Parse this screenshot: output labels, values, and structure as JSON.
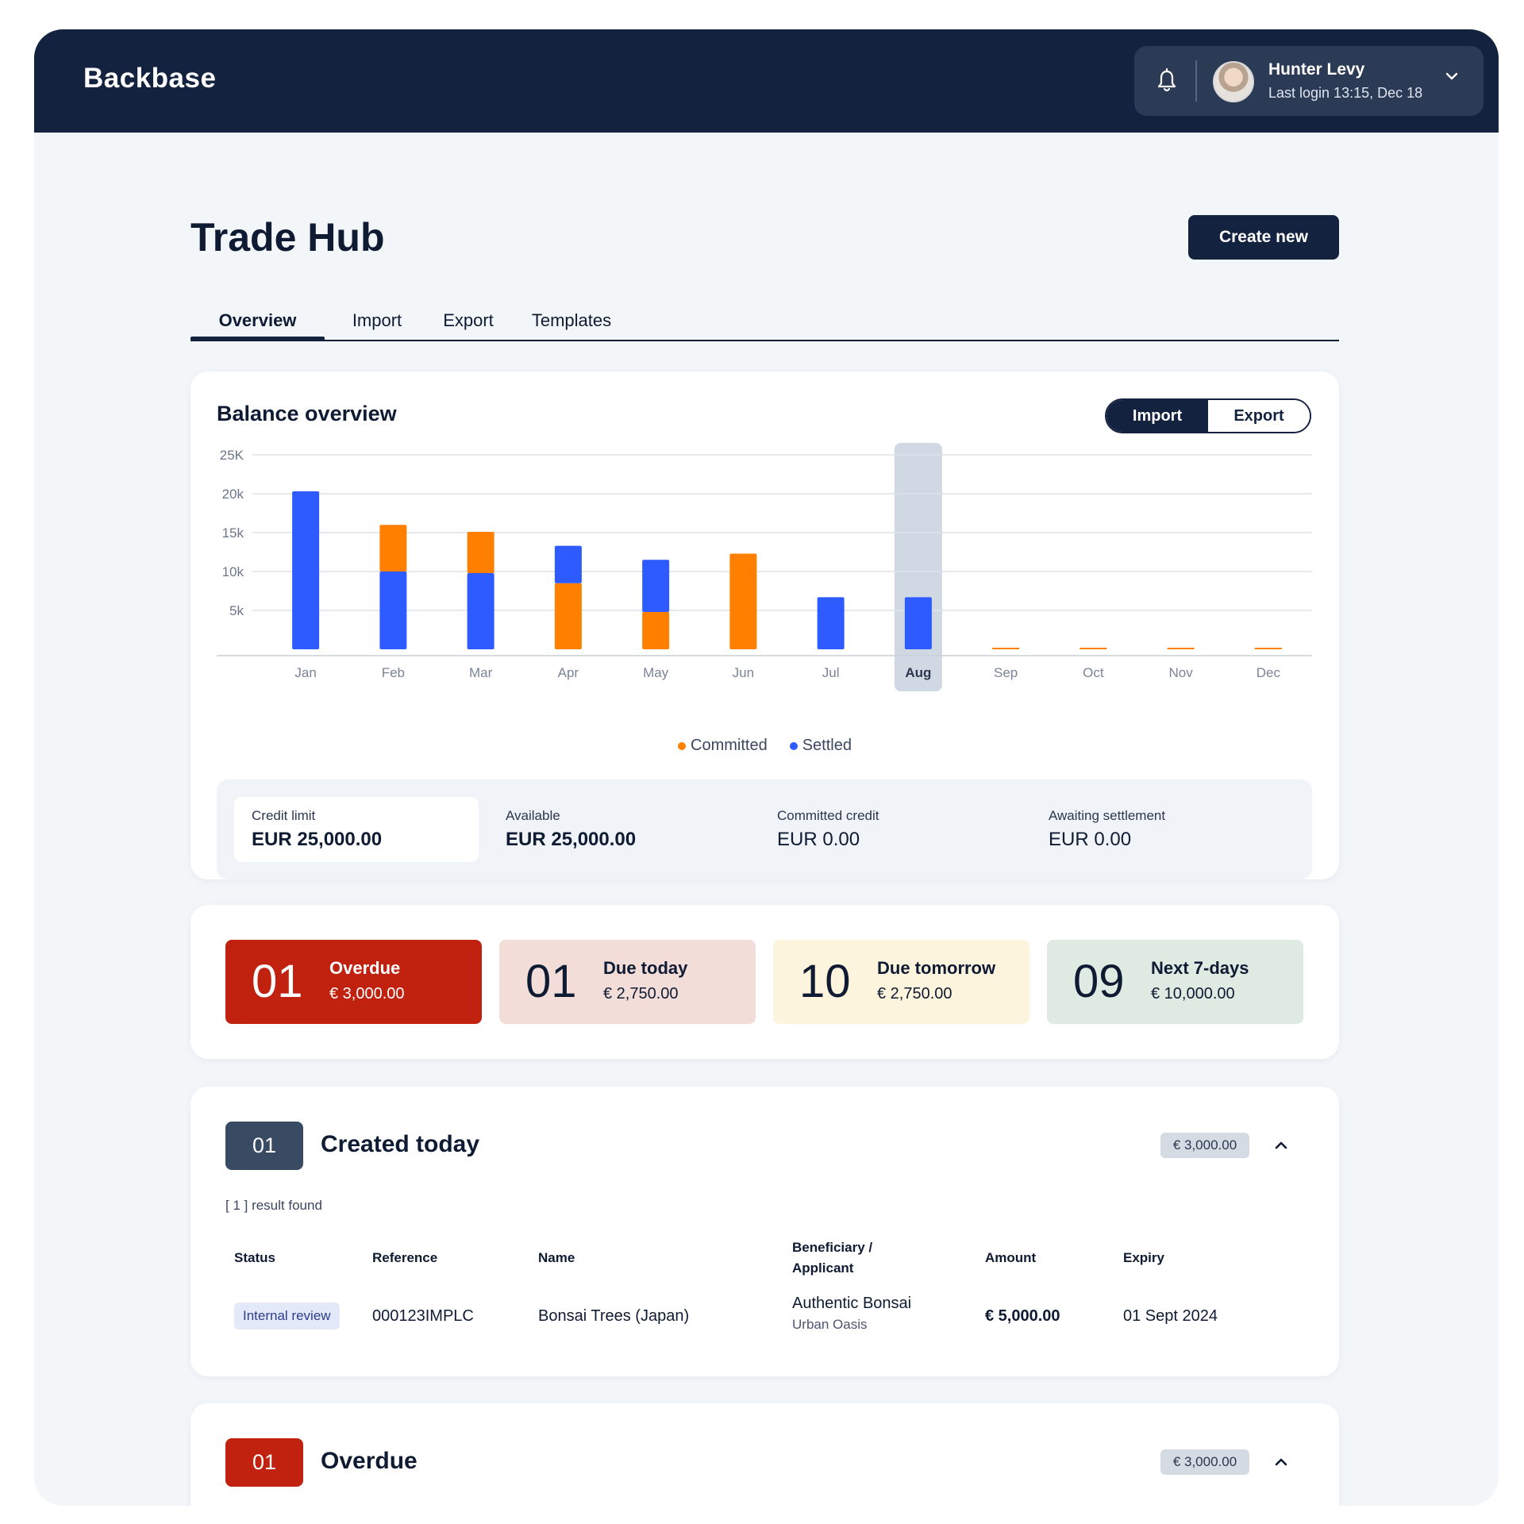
{
  "header": {
    "logo": "Backbase",
    "user_name": "Hunter Levy",
    "last_login": "Last login 13:15, Dec 18"
  },
  "page": {
    "title": "Trade Hub",
    "create_button": "Create new"
  },
  "tabs": [
    {
      "label": "Overview",
      "active": true
    },
    {
      "label": "Import",
      "active": false
    },
    {
      "label": "Export",
      "active": false
    },
    {
      "label": "Templates",
      "active": false
    }
  ],
  "balance": {
    "title": "Balance overview",
    "toggle": {
      "import_label": "Import",
      "export_label": "Export",
      "selected": "Import"
    },
    "legend": {
      "committed": "Committed",
      "settled": "Settled"
    },
    "summary": [
      {
        "label": "Credit limit",
        "value": "EUR 25,000.00"
      },
      {
        "label": "Available",
        "value": "EUR 25,000.00"
      },
      {
        "label": "Committed credit",
        "value": "EUR 0.00"
      },
      {
        "label": "Awaiting settlement",
        "value": "EUR 0.00"
      }
    ]
  },
  "chart_data": {
    "type": "bar",
    "stacked": true,
    "categories": [
      "Jan",
      "Feb",
      "Mar",
      "Apr",
      "May",
      "Jun",
      "Jul",
      "Aug",
      "Sep",
      "Oct",
      "Nov",
      "Dec"
    ],
    "highlighted_category": "Aug",
    "y_ticks": [
      "5k",
      "10k",
      "15k",
      "20k",
      "25K"
    ],
    "y_tick_values": [
      5000,
      10000,
      15000,
      20000,
      25000
    ],
    "ylim": [
      0,
      25000
    ],
    "grid": true,
    "legend_position": "bottom-center",
    "colors": {
      "Committed": "#ff7f00",
      "Settled": "#2e5bff"
    },
    "series": [
      {
        "name": "Settled",
        "values": [
          20300,
          10000,
          9800,
          4800,
          6700,
          0,
          6700,
          6700,
          0,
          0,
          0,
          0
        ]
      },
      {
        "name": "Committed",
        "values": [
          0,
          6000,
          5300,
          8500,
          4800,
          12300,
          0,
          0,
          0,
          0,
          0,
          0
        ]
      }
    ]
  },
  "status_tiles": [
    {
      "count": "01",
      "label": "Overdue",
      "amount": "€ 3,000.00",
      "bg": "#c0220f",
      "fg": "#ffffff"
    },
    {
      "count": "01",
      "label": "Due today",
      "amount": "€ 2,750.00",
      "bg": "#f3ddd9",
      "fg": "#0f1b33"
    },
    {
      "count": "10",
      "label": "Due tomorrow",
      "amount": "€ 2,750.00",
      "bg": "#fdf4de",
      "fg": "#0f1b33"
    },
    {
      "count": "09",
      "label": "Next 7-days",
      "amount": "€ 10,000.00",
      "bg": "#dfeae2",
      "fg": "#0f1b33"
    }
  ],
  "created_today": {
    "count": "01",
    "title": "Created today",
    "total": "€ 3,000.00",
    "result_count": "[ 1 ] result found",
    "columns": [
      "Status",
      "Reference",
      "Name",
      "Beneficiary /\nApplicant",
      "Amount",
      "Expiry"
    ],
    "rows": [
      {
        "status": "Internal review",
        "reference": "000123IMPLC",
        "name": "Bonsai Trees (Japan)",
        "beneficiary": "Authentic Bonsai",
        "beneficiary_sub": "Urban Oasis",
        "amount": "€ 5,000.00",
        "expiry": "01 Sept 2024"
      }
    ]
  },
  "overdue_section": {
    "count": "01",
    "title": "Overdue",
    "total": "€ 3,000.00"
  }
}
